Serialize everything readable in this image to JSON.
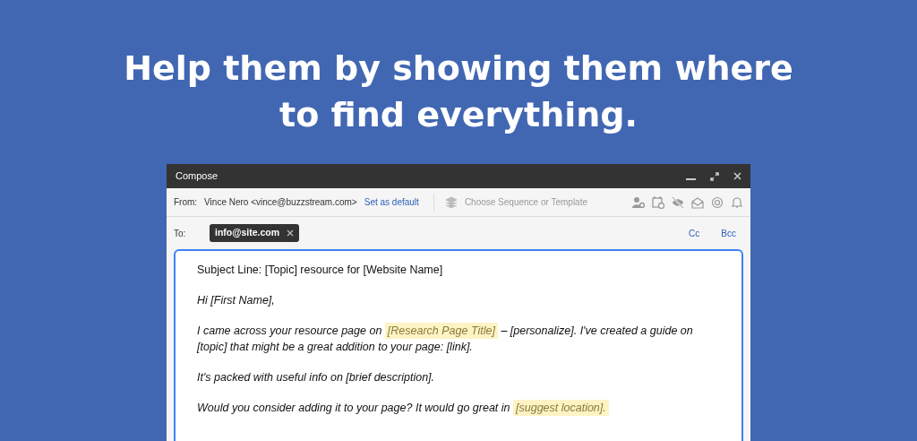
{
  "headline": "Help them by showing them where to find everything.",
  "window": {
    "title": "Compose"
  },
  "from": {
    "label": "From:",
    "value": "Vince Nero <vince@buzzstream.com>",
    "link": "Set as default"
  },
  "template": {
    "placeholder": "Choose Sequence or Template"
  },
  "to": {
    "label": "To:",
    "recipients": [
      {
        "address": "info@site.com"
      }
    ],
    "links": [
      "Cc",
      "Bcc"
    ]
  },
  "body": [
    {
      "italic": false,
      "segments": [
        {
          "text": "Subject Line: [Topic] resource for [Website Name]",
          "highlighted": false
        }
      ]
    },
    {
      "italic": true,
      "segments": [
        {
          "text": "Hi [First Name],",
          "highlighted": false
        }
      ]
    },
    {
      "italic": true,
      "segments": [
        {
          "text": "I came across your resource page on ",
          "highlighted": false
        },
        {
          "text": "[Research Page Title]",
          "highlighted": true
        },
        {
          "text": " – [personalize]. I've created a guide on [topic] that might be a great addition to your page: [link].",
          "highlighted": false
        }
      ]
    },
    {
      "italic": true,
      "segments": [
        {
          "text": "It's packed with useful info on [brief description].",
          "highlighted": false
        }
      ]
    },
    {
      "italic": true,
      "segments": [
        {
          "text": "Would you consider adding it to your page? It would go great in ",
          "highlighted": false
        },
        {
          "text": "[suggest location].",
          "highlighted": true
        }
      ]
    }
  ]
}
